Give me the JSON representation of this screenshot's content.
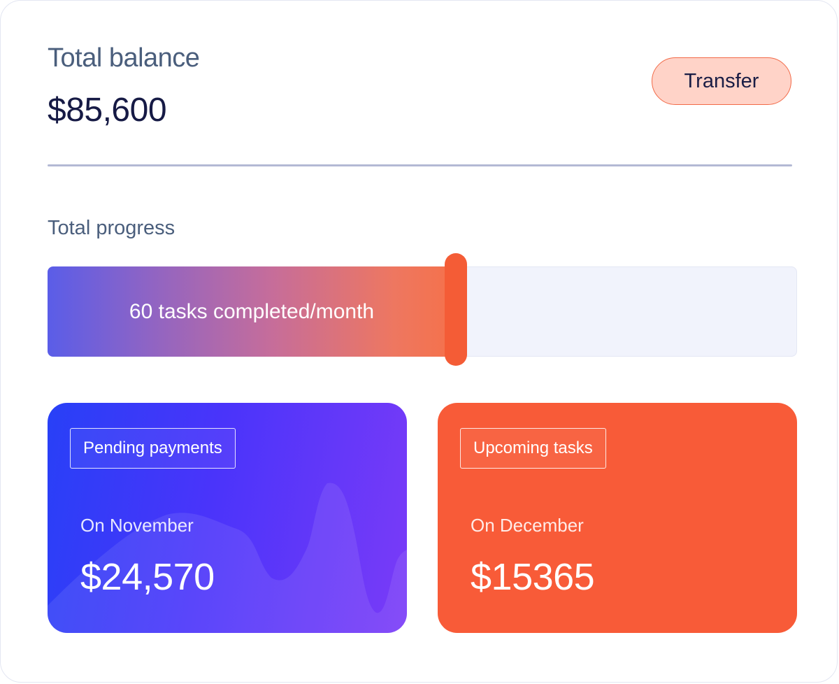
{
  "balance": {
    "label": "Total balance",
    "value": "$85,600",
    "transfer_label": "Transfer"
  },
  "progress": {
    "label": "Total progress",
    "text": "60 tasks completed/month",
    "fraction": 0.545
  },
  "cards": [
    {
      "badge": "Pending payments",
      "period": "On November",
      "amount": "$24,570"
    },
    {
      "badge": "Upcoming tasks",
      "period": "On December",
      "amount": "$15365"
    }
  ],
  "colors": {
    "accent_orange": "#f85b38",
    "accent_blue": "#2840f7",
    "accent_purple": "#7a3bf8",
    "transfer_bg": "#ffd3c8",
    "heading_text": "#4a5e7c",
    "value_text": "#161a45"
  }
}
